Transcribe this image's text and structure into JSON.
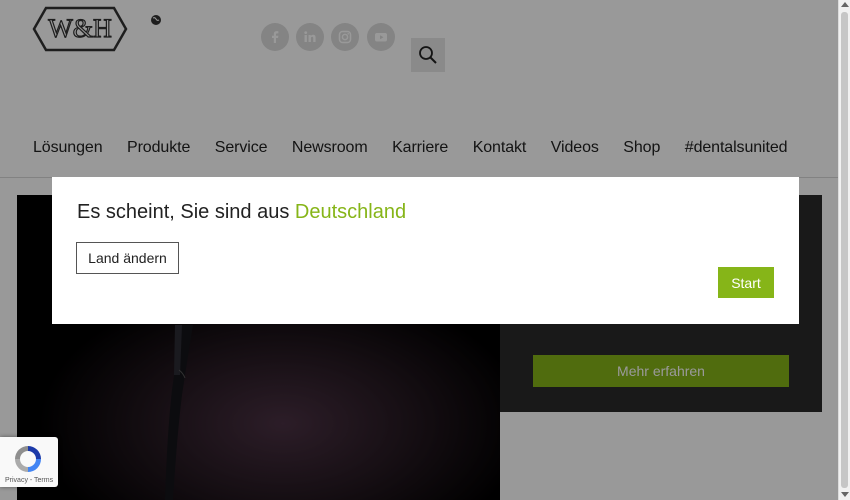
{
  "header": {
    "brand": "W&H",
    "social": [
      {
        "icon": "facebook-icon"
      },
      {
        "icon": "linkedin-icon"
      },
      {
        "icon": "instagram-icon"
      },
      {
        "icon": "youtube-icon"
      }
    ],
    "globe_icon": "globe-icon",
    "search_icon": "search-icon"
  },
  "nav": {
    "items": [
      {
        "label": "Lösungen"
      },
      {
        "label": "Produkte"
      },
      {
        "label": "Service"
      },
      {
        "label": "Newsroom"
      },
      {
        "label": "Karriere"
      },
      {
        "label": "Kontakt"
      },
      {
        "label": "Videos"
      },
      {
        "label": "Shop"
      },
      {
        "label": "#dentalsunited"
      }
    ]
  },
  "hero": {
    "more_label": "Mehr erfahren"
  },
  "modal": {
    "title_prefix": "Es scheint, Sie sind aus ",
    "country": "Deutschland",
    "change_label": "Land ändern",
    "start_label": "Start"
  },
  "recaptcha": {
    "links": "Privacy - Terms"
  },
  "colors": {
    "accent": "#86b518",
    "hero_panel": "#2b2b2b",
    "overlay": "rgba(0,0,0,0.4)"
  }
}
